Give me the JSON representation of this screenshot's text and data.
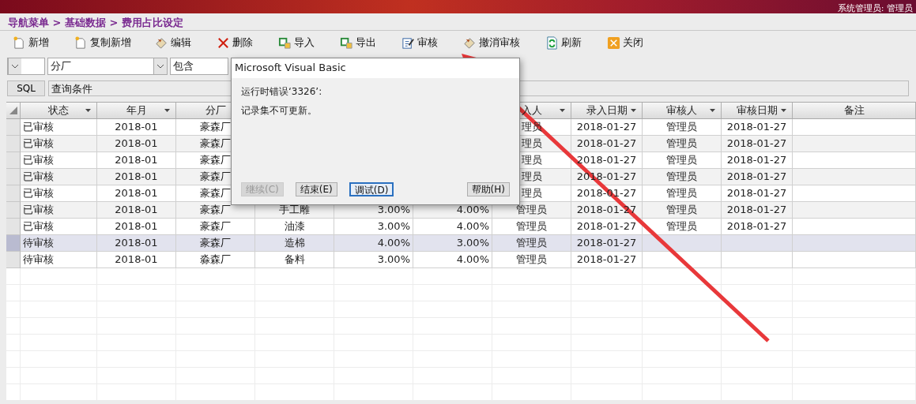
{
  "header": {
    "user": "系统管理员: 管理员"
  },
  "breadcrumb": "导航菜单 > 基础数据 > 费用占比设定",
  "toolbar": [
    {
      "label": "新增"
    },
    {
      "label": "复制新增"
    },
    {
      "label": "编辑"
    },
    {
      "label": "删除"
    },
    {
      "label": "导入"
    },
    {
      "label": "导出"
    },
    {
      "label": "审核"
    },
    {
      "label": "撤消审核"
    },
    {
      "label": "刷新"
    },
    {
      "label": "关闭"
    }
  ],
  "filter": {
    "field": "分厂",
    "operator": "包含"
  },
  "sql": {
    "button": "SQL",
    "placeholder": "查询条件"
  },
  "table": {
    "columns": [
      {
        "label": "状态",
        "dropdown": true
      },
      {
        "label": "年月",
        "dropdown": true
      },
      {
        "label": "分厂",
        "dropdown": false
      },
      {},
      {},
      {},
      {
        "label": "入人",
        "dropdown": true
      },
      {
        "label": "录入日期",
        "dropdown": true
      },
      {
        "label": "审核人",
        "dropdown": true
      },
      {
        "label": "审核日期",
        "dropdown": true
      },
      {
        "label": "备注",
        "dropdown": false
      }
    ],
    "rows": [
      {
        "selected": false,
        "cells": [
          "已审核",
          "2018-01",
          "豪森厂",
          null,
          null,
          null,
          "理员",
          "2018-01-27",
          "管理员",
          "2018-01-27",
          null
        ]
      },
      {
        "selected": false,
        "cells": [
          "已审核",
          "2018-01",
          "豪森厂",
          null,
          null,
          null,
          "理员",
          "2018-01-27",
          "管理员",
          "2018-01-27",
          null
        ]
      },
      {
        "selected": false,
        "cells": [
          "已审核",
          "2018-01",
          "豪森厂",
          null,
          null,
          null,
          "理员",
          "2018-01-27",
          "管理员",
          "2018-01-27",
          null
        ]
      },
      {
        "selected": false,
        "cells": [
          "已审核",
          "2018-01",
          "豪森厂",
          null,
          null,
          null,
          "理员",
          "2018-01-27",
          "管理员",
          "2018-01-27",
          null
        ]
      },
      {
        "selected": false,
        "cells": [
          "已审核",
          "2018-01",
          "豪森厂",
          null,
          null,
          null,
          "理员",
          "2018-01-27",
          "管理员",
          "2018-01-27",
          null
        ]
      },
      {
        "selected": false,
        "cells": [
          "已审核",
          "2018-01",
          "豪森厂",
          "手工雕",
          "3.00%",
          "4.00%",
          "管理员",
          "2018-01-27",
          "管理员",
          "2018-01-27",
          null
        ]
      },
      {
        "selected": false,
        "cells": [
          "已审核",
          "2018-01",
          "豪森厂",
          "油漆",
          "3.00%",
          "4.00%",
          "管理员",
          "2018-01-27",
          "管理员",
          "2018-01-27",
          null
        ]
      },
      {
        "selected": true,
        "cells": [
          "待审核",
          "2018-01",
          "豪森厂",
          "造棉",
          "4.00%",
          "3.00%",
          "管理员",
          "2018-01-27",
          null,
          null,
          null
        ]
      },
      {
        "selected": false,
        "cells": [
          "待审核",
          "2018-01",
          "淼森厂",
          "备料",
          "3.00%",
          "4.00%",
          "管理员",
          "2018-01-27",
          null,
          null,
          null
        ]
      }
    ]
  },
  "dialog": {
    "title": "Microsoft Visual Basic",
    "message": [
      "运行时错误‘3326’:",
      "记录集不可更新。"
    ],
    "buttons": [
      {
        "label": "继续(C)",
        "disabled": true,
        "focused": false
      },
      {
        "label": "结束(E)",
        "disabled": false,
        "focused": false
      },
      {
        "label": "调试(D)",
        "disabled": false,
        "focused": true
      },
      {
        "label": "帮助(H)",
        "disabled": false,
        "focused": false
      }
    ]
  }
}
